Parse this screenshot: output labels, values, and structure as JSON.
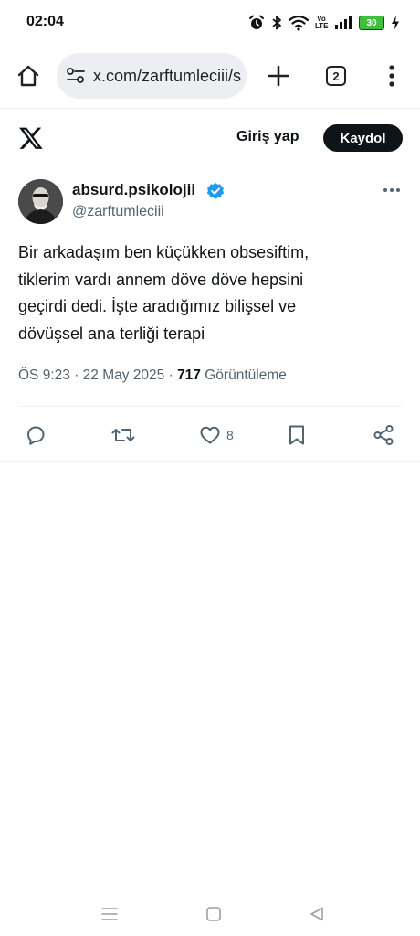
{
  "status_bar": {
    "time": "02:04",
    "volte_top": "Vo",
    "volte_bottom": "LTE",
    "battery": "30",
    "icons": [
      "alarm-icon",
      "bluetooth-icon",
      "wifi-icon",
      "volte-icon",
      "signal-icon",
      "battery-icon",
      "charging-icon"
    ]
  },
  "browser": {
    "url": "x.com/zarftumleciii/s",
    "tab_count": "2"
  },
  "x_header": {
    "login_label": "Giriş yap",
    "signup_label": "Kaydol"
  },
  "tweet": {
    "author_name": "absurd.psikolojii",
    "author_handle": "@zarftumleciii",
    "text_lines": [
      "Bir arkadaşım ben küçükken obsesiftim,",
      "tiklerim vardı annem döve döve hepsini",
      "geçirdi dedi. İşte aradığımız bilişsel ve",
      "dövüşsel ana terliği terapi"
    ],
    "time": "ÖS 9:23",
    "date": "22 May 2025",
    "views_count": "717",
    "views_label": "Görüntüleme",
    "like_count": "8"
  },
  "colors": {
    "verified": "#1d9bf0",
    "secondary_text": "#536471",
    "battery": "#3ec13a"
  }
}
